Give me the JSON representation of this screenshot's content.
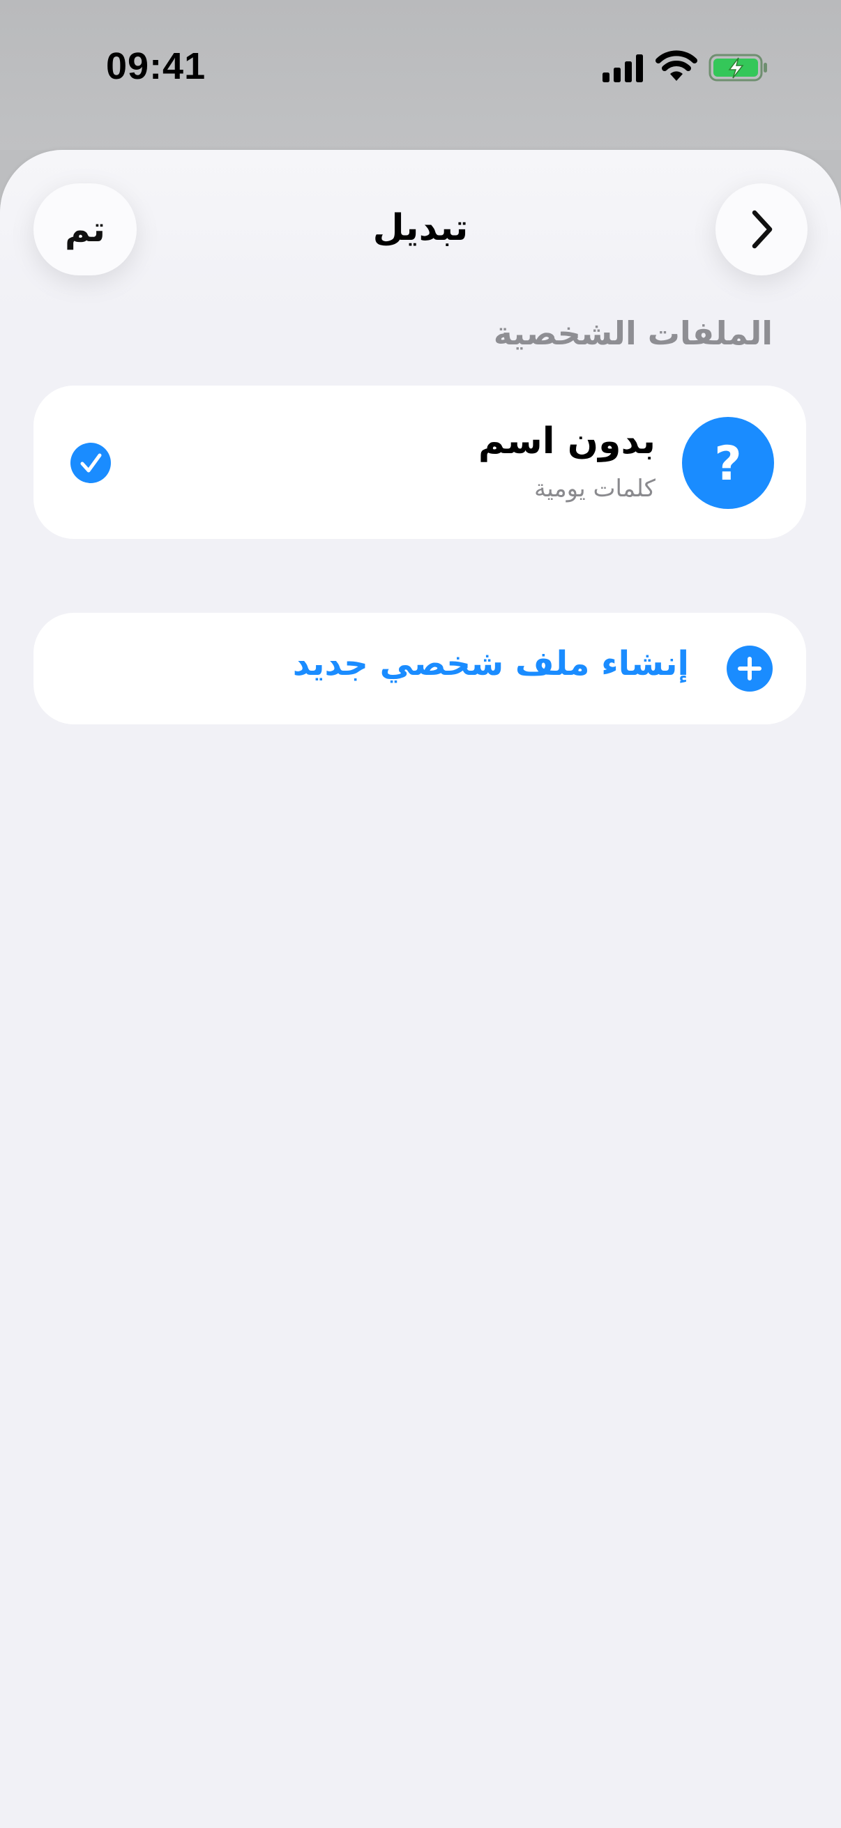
{
  "status_bar": {
    "time": "09:41",
    "signal_icon": "cellular-signal-icon",
    "wifi_icon": "wifi-icon",
    "battery_icon": "battery-charging-icon",
    "battery_color": "#34c759"
  },
  "sheet": {
    "title": "تبديل",
    "done_label": "تم",
    "back_icon": "chevron-right-icon"
  },
  "profiles_section": {
    "header": "الملفات الشخصية",
    "items": [
      {
        "name": "بدون اسم",
        "subtitle": "كلمات يومية",
        "avatar_icon": "question-mark-icon",
        "avatar_color": "#1a8cff",
        "selected": true,
        "selected_icon": "checkmark-circle-icon"
      }
    ]
  },
  "create_profile": {
    "label": "إنشاء ملف شخصي جديد",
    "icon": "plus-circle-icon",
    "accent_color": "#1a8cff"
  }
}
